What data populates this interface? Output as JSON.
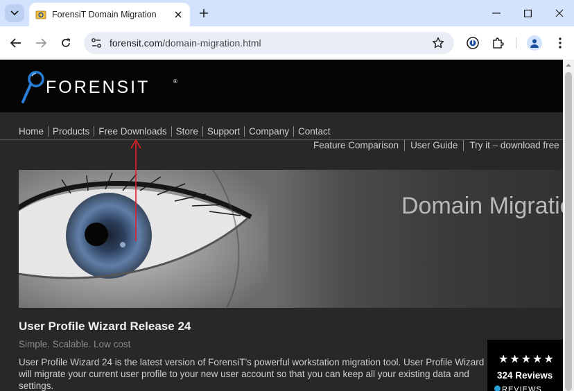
{
  "browser": {
    "tab_title": "ForensiT Domain Migration",
    "url_host": "forensit.com",
    "url_path": "/domain-migration.html"
  },
  "site": {
    "logo_text": "FORENSIT",
    "logo_reg": "®",
    "nav": [
      "Home",
      "Products",
      "Free Downloads",
      "Store",
      "Support",
      "Company",
      "Contact"
    ],
    "subnav": [
      "Feature Comparison",
      "User Guide",
      "Try it – download free"
    ],
    "banner_text": "Domain Migration",
    "heading": "User Profile Wizard Release 24",
    "tagline": "Simple. Scalable. Low cost",
    "paragraph": "User Profile Wizard 24 is the latest version of ForensiT’s powerful workstation migration tool. User Profile Wizard will migrate your current user profile to your new user account so that you can keep all your existing data and settings."
  },
  "reviews_widget": {
    "stars": "★★★★★",
    "rating": 4.5,
    "count_label": "324 Reviews",
    "brand": "REVIEWS"
  },
  "colors": {
    "tabstrip": "#d3e3fd",
    "annotation_arrow": "#e0202a"
  }
}
